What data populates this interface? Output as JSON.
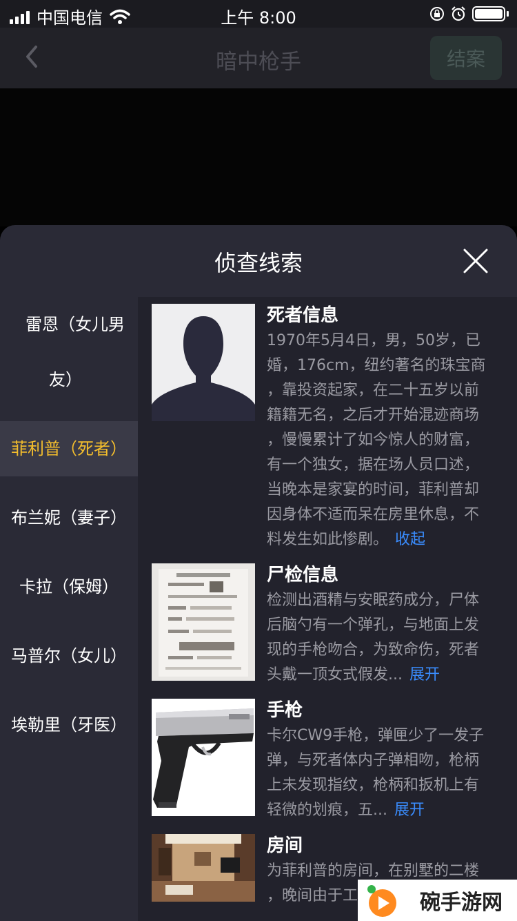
{
  "status_bar": {
    "carrier": "中国电信",
    "time": "上午 8:00",
    "icons": [
      "signal-icon",
      "wifi-icon",
      "orientation-lock-icon",
      "alarm-icon",
      "battery-icon"
    ]
  },
  "nav": {
    "title": "暗中枪手",
    "close_case_label": "结案",
    "icons": {
      "back": "chevron-left-icon"
    }
  },
  "sheet": {
    "title": "侦查线索",
    "close_icon": "close-icon"
  },
  "suspects": [
    {
      "line1": "雷恩（女儿男",
      "line2": "友）"
    },
    {
      "line1": "菲利普（死者）",
      "active": true
    },
    {
      "line1": "布兰妮（妻子）"
    },
    {
      "line1": "卡拉（保姆）"
    },
    {
      "line1": "马普尔（女儿）"
    },
    {
      "line1": "埃勒里（牙医）"
    }
  ],
  "clues": [
    {
      "title": "死者信息",
      "lines": [
        "1970年5月4日，男，50岁，已",
        "婚，176cm，纽约著名的珠宝商",
        "，靠投资起家，在二十五岁以前",
        "籍籍无名，之后才开始混迹商场",
        "，慢慢累计了如今惊人的财富，",
        "有一个独女，据在场人员口述，",
        "当晚本是家宴的时间，菲利普却",
        "因身体不适而呆在房里休息，不",
        "料发生如此惨剧。"
      ],
      "toggle": "收起"
    },
    {
      "title": "尸检信息",
      "lines": [
        "检测出酒精与安眠药成分，尸体",
        "后脑勺有一个弹孔，与地面上发",
        "现的手枪吻合，为致命伤，死者",
        "头戴一顶女式假发..."
      ],
      "toggle": "展开"
    },
    {
      "title": "手枪",
      "lines": [
        "卡尔CW9手枪，弹匣少了一发子",
        "弹，与死者体内子弹相吻，枪柄",
        "上未发现指纹，枪柄和扳机上有",
        "轻微的划痕，五..."
      ],
      "toggle": "展开"
    },
    {
      "title": "房间",
      "lines": [
        "为菲利普的房间，在别墅的二楼",
        "，晚间由于工"
      ],
      "toggle": ""
    }
  ],
  "watermark": {
    "text": "碗手游网"
  },
  "colors": {
    "accent": "#f3bd2d",
    "link": "#3a8dff",
    "sheet_bg": "#2a2a36",
    "content_bg": "#22222c"
  }
}
